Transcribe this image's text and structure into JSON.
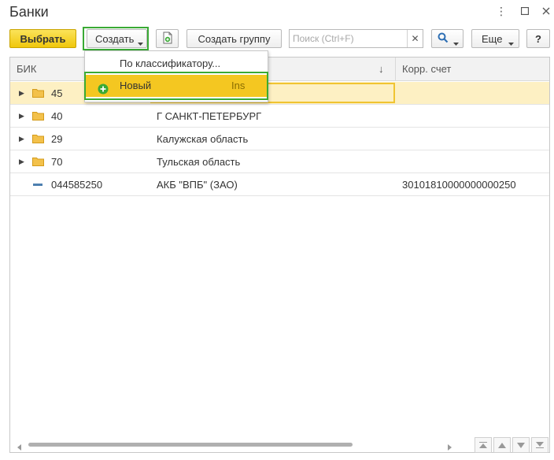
{
  "window": {
    "title": "Банки"
  },
  "toolbar": {
    "select_label": "Выбрать",
    "create_label": "Создать",
    "create_group_label": "Создать группу",
    "search_placeholder": "Поиск (Ctrl+F)",
    "more_label": "Еще",
    "help_label": "?"
  },
  "create_menu": {
    "items": [
      {
        "label": "По классификатору...",
        "shortcut": ""
      },
      {
        "label": "Новый",
        "shortcut": "Ins"
      }
    ]
  },
  "table": {
    "columns": [
      "БИК",
      "",
      "Корр. счет"
    ],
    "sort_indicator": "↓",
    "rows": [
      {
        "type": "group",
        "bik": "45",
        "name": "",
        "corr_account": "",
        "selected": true
      },
      {
        "type": "group",
        "bik": "40",
        "name": "Г САНКТ-ПЕТЕРБУРГ",
        "corr_account": "",
        "selected": false
      },
      {
        "type": "group",
        "bik": "29",
        "name": "Калужская область",
        "corr_account": "",
        "selected": false
      },
      {
        "type": "group",
        "bik": "70",
        "name": "Тульская область",
        "corr_account": "",
        "selected": false
      },
      {
        "type": "item",
        "bik": "044585250",
        "name": "АКБ \"ВПБ\" (ЗАО)",
        "corr_account": "30101810000000000250",
        "selected": false
      }
    ]
  },
  "colors": {
    "accent_yellow": "#f4c721",
    "highlight_green": "#3aaa35",
    "selected_row": "#fdf0c3",
    "folder": "#f3c14b"
  }
}
